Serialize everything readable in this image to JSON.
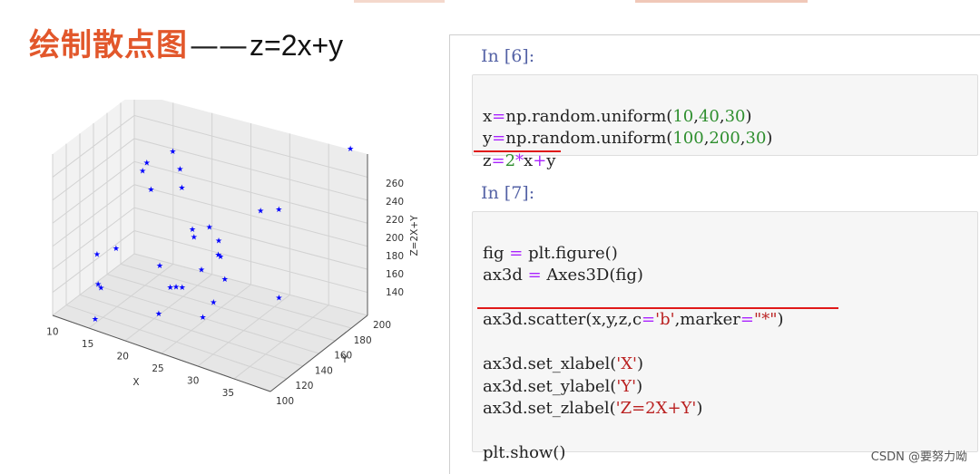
{
  "title": {
    "chinese": "绘制散点图",
    "dash": "——",
    "equation": "z=2x+y"
  },
  "chart_data": {
    "type": "scatter",
    "title": "",
    "xlabel": "X",
    "ylabel": "Y",
    "zlabel": "Z=2X+Y",
    "x_ticks": [
      "10",
      "15",
      "20",
      "25",
      "30",
      "35"
    ],
    "y_ticks": [
      "100",
      "120",
      "140",
      "160",
      "180",
      "200"
    ],
    "z_ticks": [
      "140",
      "160",
      "180",
      "200",
      "220",
      "240",
      "260"
    ],
    "xlim": [
      10,
      40
    ],
    "ylim": [
      100,
      200
    ],
    "zlim": [
      130,
      270
    ],
    "marker": "*",
    "color": "#0000ff",
    "grid": true,
    "points_note": "30 points, x uniform(10,40), y uniform(100,200), z=2x+y"
  },
  "notebook": {
    "cell1": {
      "prompt": "In [6]:",
      "lines": [
        "x=np.random.uniform(10,40,30)",
        "y=np.random.uniform(100,200,30)",
        "z=2*x+y"
      ]
    },
    "cell2": {
      "prompt": "In [7]:",
      "lines": [
        "fig = plt.figure()",
        "ax3d = Axes3D(fig)",
        "",
        "ax3d.scatter(x,y,z,c='b',marker=\"*\")",
        "",
        "ax3d.set_xlabel('X')",
        "ax3d.set_ylabel('Y')",
        "ax3d.set_zlabel('Z=2X+Y')",
        "",
        "plt.show()"
      ]
    }
  },
  "watermark": "CSDN @要努力呦"
}
